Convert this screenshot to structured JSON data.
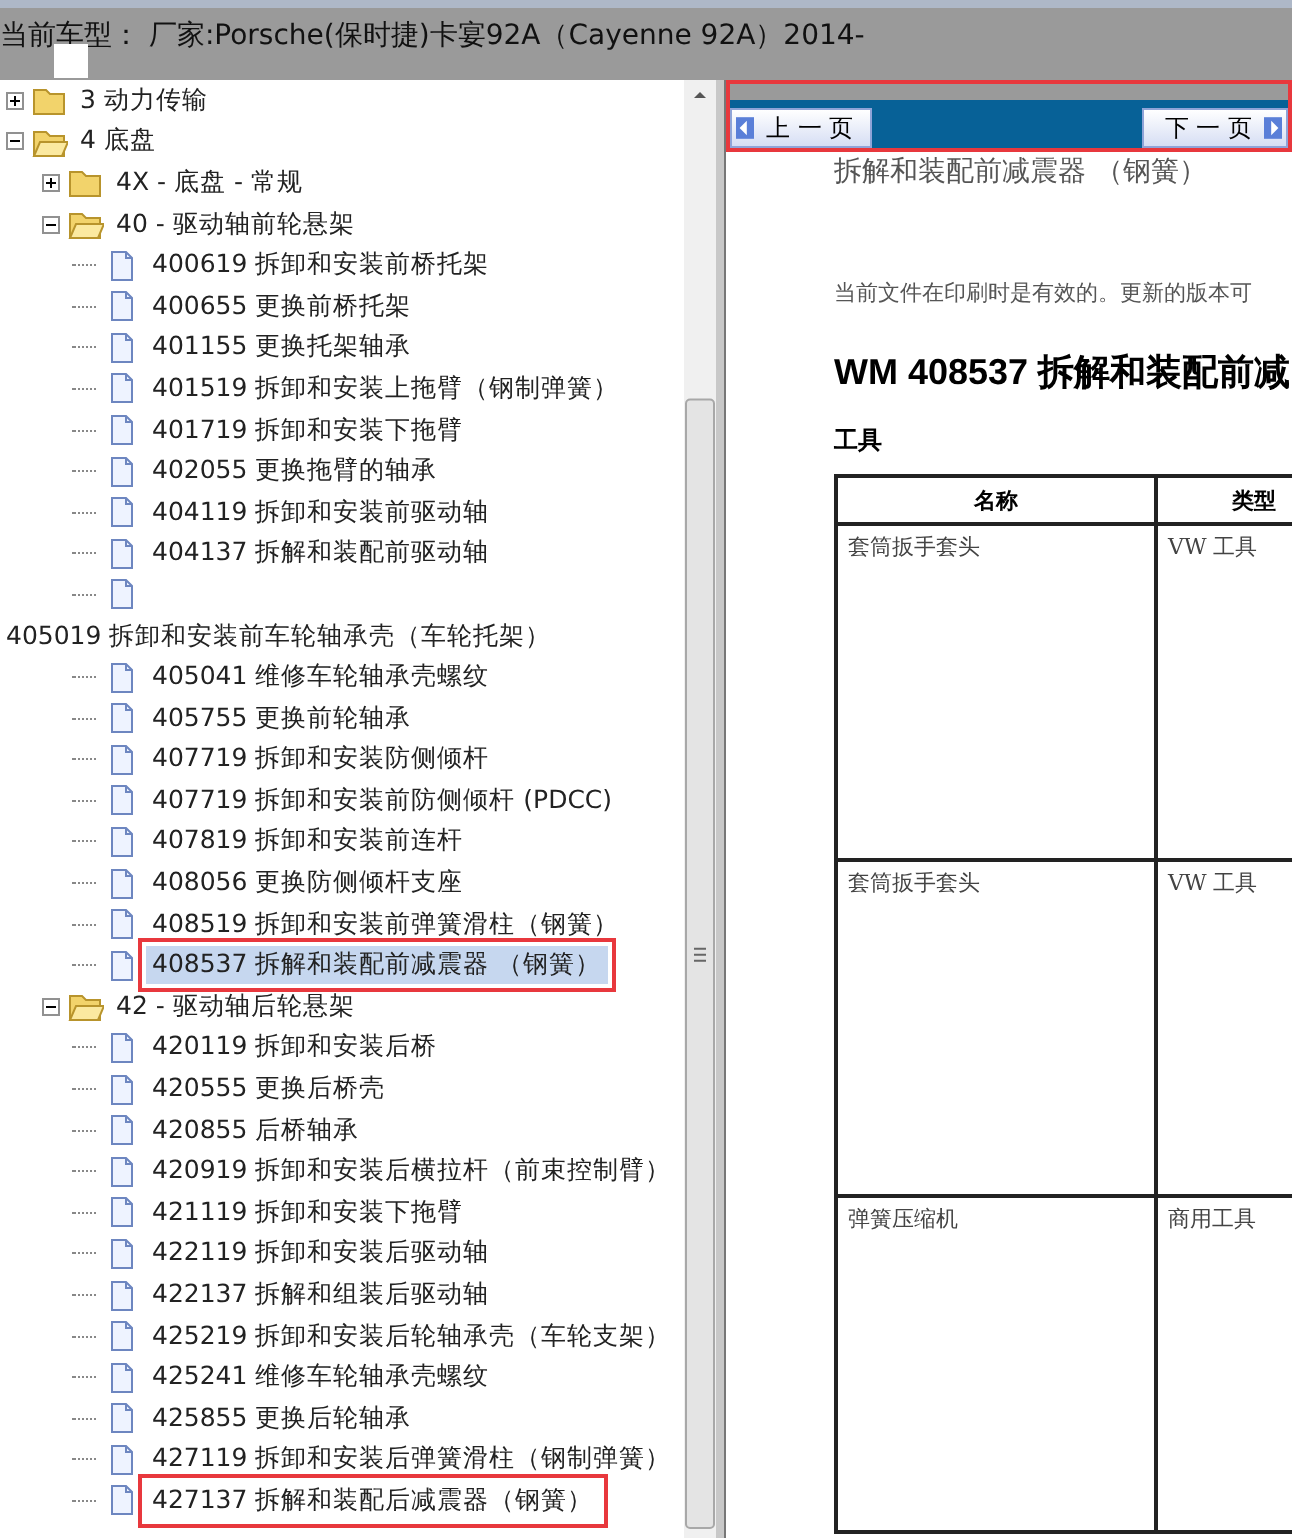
{
  "header": {
    "title": "当前车型：  厂家:Porsche(保时捷)卡宴92A（Cayenne 92A）2014-"
  },
  "tree": [
    {
      "kind": "folder",
      "label": "3 动力传输",
      "expanded": false,
      "selected": false,
      "highlighted": false
    },
    {
      "kind": "folder",
      "label": "4 底盘",
      "expanded": true,
      "selected": false,
      "highlighted": false,
      "children": [
        {
          "kind": "folder",
          "label": "4X - 底盘 - 常规",
          "expanded": false,
          "selected": false,
          "highlighted": false
        },
        {
          "kind": "folder",
          "label": "40 - 驱动轴前轮悬架",
          "expanded": true,
          "selected": false,
          "highlighted": false,
          "children": [
            {
              "kind": "doc",
              "label": "400619 拆卸和安装前桥托架",
              "selected": false,
              "highlighted": false
            },
            {
              "kind": "doc",
              "label": "400655 更换前桥托架",
              "selected": false,
              "highlighted": false
            },
            {
              "kind": "doc",
              "label": "401155 更换托架轴承",
              "selected": false,
              "highlighted": false
            },
            {
              "kind": "doc",
              "label": "401519 拆卸和安装上拖臂（钢制弹簧）",
              "selected": false,
              "highlighted": false
            },
            {
              "kind": "doc",
              "label": "401719 拆卸和安装下拖臂",
              "selected": false,
              "highlighted": false
            },
            {
              "kind": "doc",
              "label": "402055 更换拖臂的轴承",
              "selected": false,
              "highlighted": false
            },
            {
              "kind": "doc",
              "label": "404119 拆卸和安装前驱动轴",
              "selected": false,
              "highlighted": false
            },
            {
              "kind": "doc",
              "label": "404137 拆解和装配前驱动轴",
              "selected": false,
              "highlighted": false
            },
            {
              "kind": "doc",
              "selected": false,
              "highlighted": false
            },
            {
              "kind": "detached",
              "label": "405019 拆卸和安装前车轮轴承壳（车轮托架）",
              "selected": false,
              "highlighted": false
            },
            {
              "kind": "doc",
              "label": "405041 维修车轮轴承壳螺纹",
              "selected": false,
              "highlighted": false
            },
            {
              "kind": "doc",
              "label": "405755 更换前轮轴承",
              "selected": false,
              "highlighted": false
            },
            {
              "kind": "doc",
              "label": "407719 拆卸和安装防侧倾杆",
              "selected": false,
              "highlighted": false
            },
            {
              "kind": "doc",
              "label": "407719 拆卸和安装前防侧倾杆 (PDCC)",
              "selected": false,
              "highlighted": false
            },
            {
              "kind": "doc",
              "label": "407819 拆卸和安装前连杆",
              "selected": false,
              "highlighted": false
            },
            {
              "kind": "doc",
              "label": "408056 更换防侧倾杆支座",
              "selected": false,
              "highlighted": false
            },
            {
              "kind": "doc",
              "label": "408519 拆卸和安装前弹簧滑柱（钢簧）",
              "selected": false,
              "highlighted": false
            },
            {
              "kind": "doc",
              "label": "408537 拆解和装配前减震器 （钢簧）",
              "selected": true,
              "highlighted": true
            }
          ]
        },
        {
          "kind": "folder",
          "label": "42 - 驱动轴后轮悬架",
          "expanded": true,
          "selected": false,
          "highlighted": false,
          "children": [
            {
              "kind": "doc",
              "label": "420119 拆卸和安装后桥",
              "selected": false,
              "highlighted": false
            },
            {
              "kind": "doc",
              "label": "420555 更换后桥壳",
              "selected": false,
              "highlighted": false
            },
            {
              "kind": "doc",
              "label": "420855 后桥轴承",
              "selected": false,
              "highlighted": false
            },
            {
              "kind": "doc",
              "label": "420919 拆卸和安装后横拉杆（前束控制臂）",
              "selected": false,
              "highlighted": false
            },
            {
              "kind": "doc",
              "label": "421119 拆卸和安装下拖臂",
              "selected": false,
              "highlighted": false
            },
            {
              "kind": "doc",
              "label": "422119 拆卸和安装后驱动轴",
              "selected": false,
              "highlighted": false
            },
            {
              "kind": "doc",
              "label": "422137 拆解和组装后驱动轴",
              "selected": false,
              "highlighted": false
            },
            {
              "kind": "doc",
              "label": "425219 拆卸和安装后轮轴承壳（车轮支架）",
              "selected": false,
              "highlighted": false
            },
            {
              "kind": "doc",
              "label": "425241 维修车轮轴承壳螺纹",
              "selected": false,
              "highlighted": false
            },
            {
              "kind": "doc",
              "label": "425855 更换后轮轴承",
              "selected": false,
              "highlighted": false
            },
            {
              "kind": "doc",
              "label": "427119 拆卸和安装后弹簧滑柱（钢制弹簧）",
              "selected": false,
              "highlighted": false
            },
            {
              "kind": "doc",
              "label": "427137 拆解和装配后减震器（钢簧）",
              "selected": false,
              "highlighted": true
            }
          ]
        }
      ]
    }
  ],
  "nav": {
    "highlighted": true,
    "buttons": [
      {
        "kind": "prev",
        "label": "上 一 页"
      },
      {
        "kind": "next",
        "label": "下 一 页"
      }
    ]
  },
  "document": {
    "title": "拆解和装配前减震器 （钢簧）",
    "notice": "当前文件在印刷时是有效的。更新的版本可",
    "heading": "WM 408537 拆解和装配前减",
    "section": "工具",
    "table": {
      "columns": [
        "名称",
        "类型"
      ],
      "rows": [
        [
          "套筒扳手套头",
          "VW 工具"
        ],
        [
          "套筒扳手套头",
          "VW 工具"
        ],
        [
          "弹簧压缩机",
          "商用工具"
        ]
      ]
    }
  }
}
